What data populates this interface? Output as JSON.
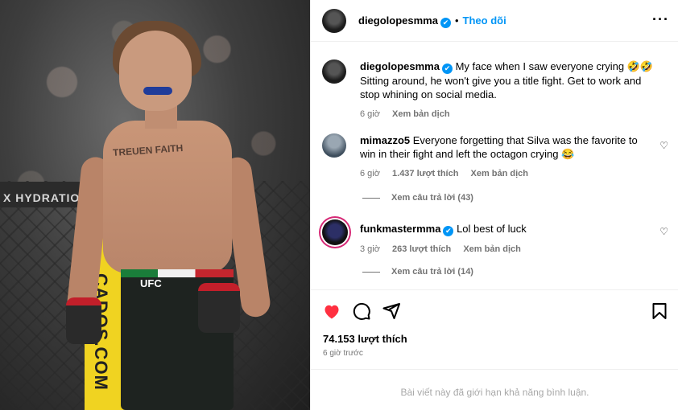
{
  "post_image": {
    "banner_text": "X HYDRATION",
    "pole_text": "CADOS.COM",
    "shorts_logo": "UFC",
    "tattoo_text": "TREUEN FAITH"
  },
  "header": {
    "username": "diegolopesmma",
    "verified_mark": "✔",
    "separator": "•",
    "follow_label": "Theo dõi",
    "more_label": "···"
  },
  "caption": {
    "username": "diegolopesmma",
    "verified_mark": "✔",
    "text": "My face when I saw everyone crying 🤣🤣 Sitting around, he won't give you a title fight. Get to work and stop whining on social media.",
    "time": "6 giờ",
    "translate": "Xem bản dịch"
  },
  "comments": [
    {
      "username": "mimazzo5",
      "text": "Everyone forgetting that Silva was the favorite to win in their fight and left the octagon crying 😂",
      "time": "6 giờ",
      "likes": "1.437 lượt thích",
      "translate": "Xem bản dịch",
      "replies": "Xem câu trả lời (43)",
      "heart": "♡"
    },
    {
      "username": "funkmastermma",
      "verified_mark": "✔",
      "text": "Lol best of luck",
      "time": "3 giờ",
      "likes": "263 lượt thích",
      "translate": "Xem bản dịch",
      "replies": "Xem câu trả lời (14)",
      "heart": "♡"
    }
  ],
  "actions": {
    "likes": "74.153 lượt thích",
    "time": "6 giờ trước",
    "comments_limited": "Bài viết này đã giới hạn khả năng bình luận.",
    "like_color": "#ff3040"
  }
}
